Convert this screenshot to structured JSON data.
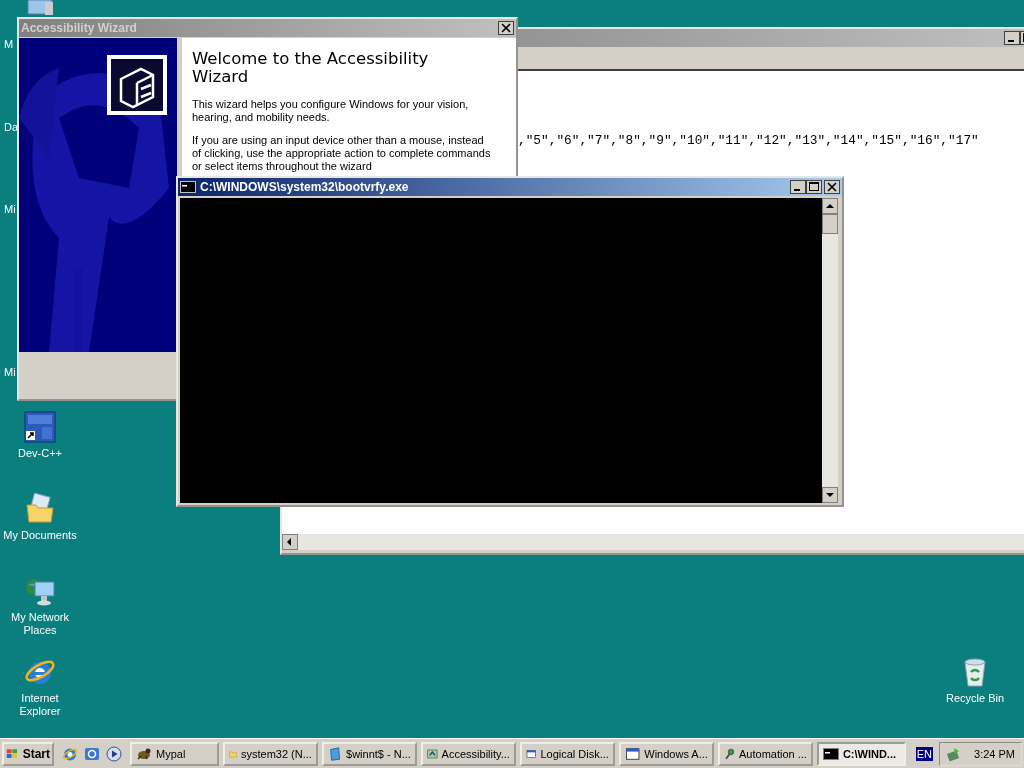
{
  "partial_icon_labels": [
    {
      "label": "M"
    },
    {
      "label": "Da"
    },
    {
      "label": "Mi"
    },
    {
      "label": "Mi"
    }
  ],
  "desktop_icons": [
    {
      "kind": "dev",
      "label": "Dev-C++"
    },
    {
      "kind": "documents",
      "label": "My Documents"
    },
    {
      "kind": "network",
      "label": "My Network Places"
    },
    {
      "kind": "ie",
      "label": "Internet Explorer"
    },
    {
      "kind": "recycle",
      "label": "Recycle Bin"
    }
  ],
  "background_window": {
    "active": false,
    "text_line": ",\"5\",\"6\",\"7\",\"8\",\"9\",\"10\",\"11\",\"12\",\"13\",\"14\",\"15\",\"16\",\"17\""
  },
  "wizard": {
    "title": "Accessibility Wizard",
    "active": false,
    "heading": "Welcome to the Accessibility Wizard",
    "paragraphs": [
      "This wizard helps you configure Windows for your vision, hearing, and mobility needs.",
      "If you are using an input device other than a mouse, instead of clicking, use the appropriate action to complete commands or select items throughout the wizard"
    ]
  },
  "console": {
    "title": "C:\\WINDOWS\\system32\\bootvrfy.exe",
    "active": true
  },
  "taskbar": {
    "start": "Start",
    "quick_launch": [
      {
        "kind": "ie"
      },
      {
        "kind": "outlook"
      },
      {
        "kind": "media"
      }
    ],
    "tasks": [
      {
        "kind": "mypal",
        "label": "Mypal",
        "selected": false
      },
      {
        "kind": "folder",
        "label": "system32 (N...",
        "selected": false
      },
      {
        "kind": "notepad",
        "label": "$winnt$ - N...",
        "selected": false
      },
      {
        "kind": "wizard",
        "label": "Accessibility...",
        "selected": false
      },
      {
        "kind": "window",
        "label": "Logical Disk...",
        "selected": false
      },
      {
        "kind": "window",
        "label": "Windows A...",
        "selected": false
      },
      {
        "kind": "automation",
        "label": "Automation ...",
        "selected": false
      },
      {
        "kind": "console",
        "label": "C:\\WIND...",
        "selected": true
      }
    ],
    "language": "EN",
    "clock": "3:24 PM"
  }
}
